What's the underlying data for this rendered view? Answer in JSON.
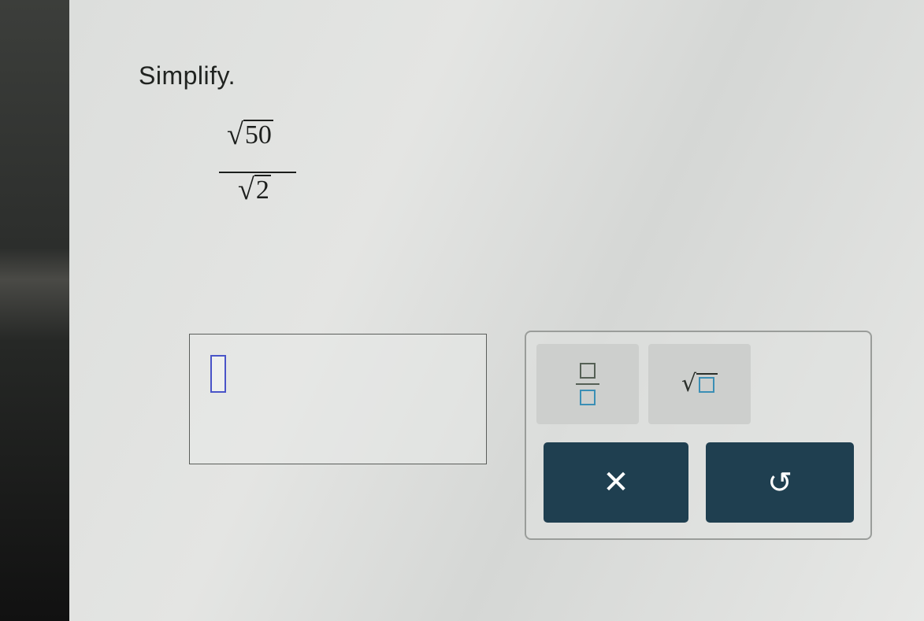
{
  "question": {
    "instruction": "Simplify.",
    "expression": {
      "numerator_radicand": "50",
      "denominator_radicand": "2"
    }
  },
  "answer": {
    "value": ""
  },
  "keypad": {
    "tools": [
      {
        "name": "fraction",
        "icon": "fraction-template-icon"
      },
      {
        "name": "square-root",
        "icon": "square-root-template-icon"
      }
    ],
    "actions": [
      {
        "name": "clear",
        "icon": "close-icon",
        "glyph": "✕"
      },
      {
        "name": "undo",
        "icon": "undo-icon",
        "glyph": "↺"
      }
    ],
    "accent": "#1f3f50",
    "input_highlight": "#4a55c8"
  }
}
